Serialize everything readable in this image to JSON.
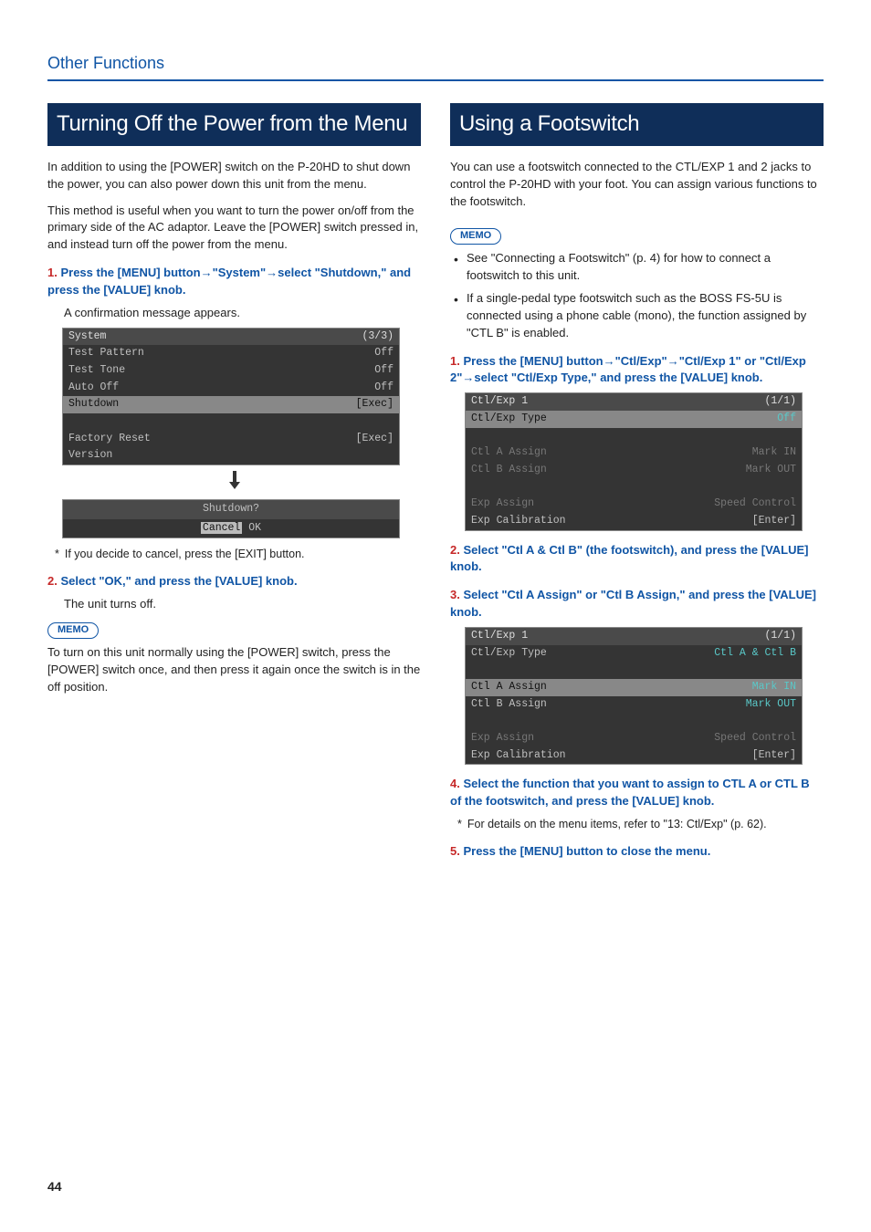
{
  "breadcrumb": "Other Functions",
  "page_number": "44",
  "left": {
    "title": "Turning Off the Power from the Menu",
    "intro1": "In addition to using the [POWER] switch on the P-20HD to shut down the power, you can also power down this unit from the menu.",
    "intro2": "This method is useful when you want to turn the power on/off from the primary side of the AC adaptor. Leave the [POWER] switch pressed in, and instead turn off the power from the menu.",
    "step1_num": "1.",
    "step1_text": "Press the [MENU] button→\"System\"→select \"Shutdown,\" and press the [VALUE] knob.",
    "step1_sub": "A confirmation message appears.",
    "term1": {
      "header_left": "System",
      "header_right": "(3/3)",
      "rows": [
        {
          "l": "Test Pattern",
          "r": "Off"
        },
        {
          "l": "Test Tone",
          "r": "Off"
        },
        {
          "l": "Auto Off",
          "r": "Off"
        },
        {
          "l": "Shutdown",
          "r": "[Exec]",
          "hl": true
        },
        {
          "l": "",
          "r": ""
        },
        {
          "l": "Factory Reset",
          "r": "[Exec]"
        },
        {
          "l": "Version",
          "r": ""
        }
      ]
    },
    "dialog": {
      "title": "Shutdown?",
      "cancel": "Cancel",
      "ok": "OK"
    },
    "note_star": "If you decide to cancel, press the [EXIT] button.",
    "step2_num": "2.",
    "step2_text": "Select \"OK,\" and press the [VALUE] knob.",
    "step2_sub": "The unit turns off.",
    "memo_label": "MEMO",
    "memo_text": "To turn on this unit normally using the [POWER] switch, press the [POWER] switch once, and then press it again once the switch is in the off position."
  },
  "right": {
    "title": "Using a Footswitch",
    "intro": "You can use a footswitch connected to the CTL/EXP 1 and 2 jacks to control the P-20HD with your foot. You can assign various functions to the footswitch.",
    "memo_label": "MEMO",
    "memo_items": [
      "See \"Connecting a Footswitch\" (p. 4) for how to connect a footswitch to this unit.",
      "If a single-pedal type footswitch such as the BOSS FS-5U is connected using a phone cable (mono), the function assigned by \"CTL B\" is enabled."
    ],
    "step1_num": "1.",
    "step1_text": "Press the [MENU] button→\"Ctl/Exp\"→\"Ctl/Exp 1\" or \"Ctl/Exp 2\"→select \"Ctl/Exp Type,\" and press the [VALUE] knob.",
    "term1": {
      "header_left": "Ctl/Exp 1",
      "header_right": "(1/1)",
      "rows": [
        {
          "l": "Ctl/Exp Type",
          "r": "Off",
          "hl": true,
          "cyan": true
        },
        {
          "l": "",
          "r": ""
        },
        {
          "l": "Ctl A Assign",
          "r": "Mark IN",
          "dim": true
        },
        {
          "l": "Ctl B Assign",
          "r": "Mark OUT",
          "dim": true
        },
        {
          "l": "",
          "r": ""
        },
        {
          "l": "Exp Assign",
          "r": "Speed Control",
          "dim": true
        },
        {
          "l": "Exp Calibration",
          "r": "[Enter]"
        }
      ]
    },
    "step2_num": "2.",
    "step2_text": "Select \"Ctl A & Ctl B\" (the footswitch), and press the [VALUE] knob.",
    "step3_num": "3.",
    "step3_text": "Select \"Ctl A Assign\" or \"Ctl B Assign,\" and press the [VALUE] knob.",
    "term2": {
      "header_left": "Ctl/Exp 1",
      "header_right": "(1/1)",
      "rows": [
        {
          "l": "Ctl/Exp Type",
          "r": "Ctl A & Ctl B",
          "cyan": true
        },
        {
          "l": "",
          "r": ""
        },
        {
          "l": "Ctl A Assign",
          "r": "Mark IN",
          "hl": true,
          "cyan": true
        },
        {
          "l": "Ctl B Assign",
          "r": "Mark OUT",
          "cyan": true
        },
        {
          "l": "",
          "r": ""
        },
        {
          "l": "Exp Assign",
          "r": "Speed Control",
          "dim": true
        },
        {
          "l": "Exp Calibration",
          "r": "[Enter]"
        }
      ]
    },
    "step4_num": "4.",
    "step4_text": "Select the function that you want to assign to CTL A or CTL B of the footswitch, and press the [VALUE] knob.",
    "note_star": "For details on the menu items, refer to \"13: Ctl/Exp\" (p. 62).",
    "step5_num": "5.",
    "step5_text": "Press the [MENU] button to close the menu."
  }
}
